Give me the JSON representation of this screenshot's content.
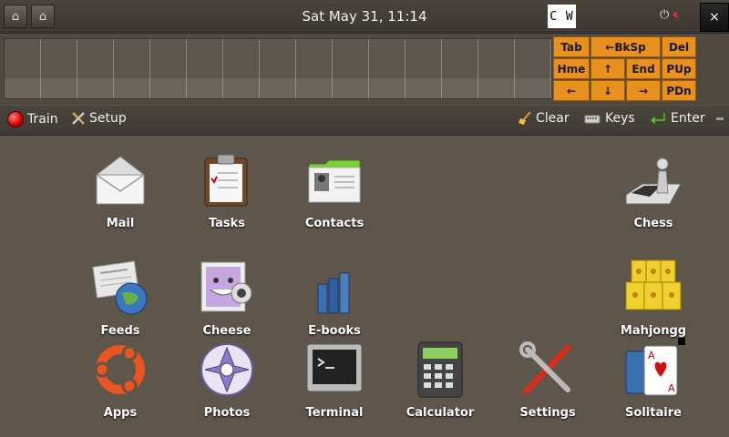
{
  "topbar": {
    "clock": "Sat May 31, 11:14",
    "logo_text": "C W",
    "close_label": "×"
  },
  "keyboard": {
    "keys": [
      "Tab",
      "←BkSp",
      "Del",
      "Hme",
      "↑",
      "End",
      "PUp",
      "←",
      "↓",
      "→",
      "PDn"
    ]
  },
  "toolbar": {
    "train": "Train",
    "setup": "Setup",
    "clear": "Clear",
    "keys": "Keys",
    "enter": "Enter"
  },
  "apps": [
    {
      "label": "Mail",
      "icon": "mail-icon"
    },
    {
      "label": "Tasks",
      "icon": "tasks-icon"
    },
    {
      "label": "Contacts",
      "icon": "contacts-icon"
    },
    {
      "label": "Chess",
      "icon": "chess-icon"
    },
    {
      "label": "Feeds",
      "icon": "feeds-icon"
    },
    {
      "label": "Cheese",
      "icon": "cheese-icon"
    },
    {
      "label": "E-books",
      "icon": "ebooks-icon"
    },
    {
      "label": "Mahjongg",
      "icon": "mahjongg-icon"
    },
    {
      "label": "Apps",
      "icon": "ubuntu-icon"
    },
    {
      "label": "Photos",
      "icon": "photos-icon"
    },
    {
      "label": "Terminal",
      "icon": "terminal-icon"
    },
    {
      "label": "Calculator",
      "icon": "calculator-icon"
    },
    {
      "label": "Settings",
      "icon": "settings-icon"
    },
    {
      "label": "Solitaire",
      "icon": "solitaire-icon"
    }
  ]
}
